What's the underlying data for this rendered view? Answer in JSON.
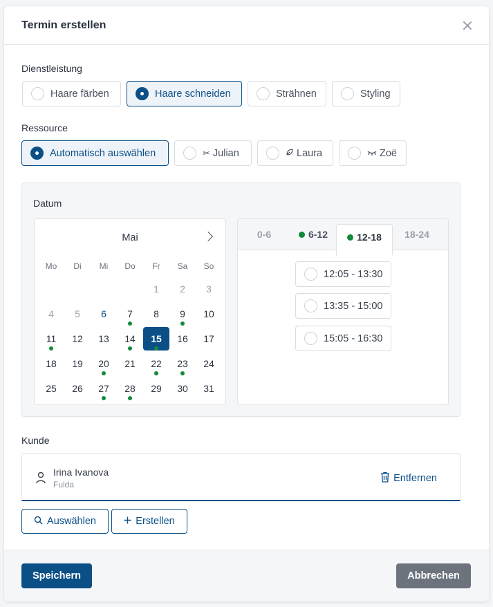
{
  "modal": {
    "title": "Termin erstellen"
  },
  "service": {
    "label": "Dienstleistung",
    "options": [
      {
        "label": "Haare färben",
        "selected": false
      },
      {
        "label": "Haare schneiden",
        "selected": true
      },
      {
        "label": "Strähnen",
        "selected": false
      },
      {
        "label": "Styling",
        "selected": false
      }
    ]
  },
  "resource": {
    "label": "Ressource",
    "options": [
      {
        "label": "Automatisch auswählen",
        "icon": "",
        "selected": true
      },
      {
        "label": "Julian",
        "icon": "scissors-icon",
        "selected": false
      },
      {
        "label": "Laura",
        "icon": "leaf-icon",
        "selected": false
      },
      {
        "label": "Zoë",
        "icon": "eyelash-icon",
        "selected": false
      }
    ]
  },
  "date": {
    "label": "Datum",
    "month": "Mai",
    "weekdays": [
      "Mo",
      "Di",
      "Mi",
      "Do",
      "Fr",
      "Sa",
      "So"
    ],
    "weeks": [
      [
        "",
        "",
        "",
        "",
        "1",
        "2",
        "3"
      ],
      [
        "4",
        "5",
        "6",
        "7",
        "8",
        "9",
        "10"
      ],
      [
        "11",
        "12",
        "13",
        "14",
        "15",
        "16",
        "17"
      ],
      [
        "18",
        "19",
        "20",
        "21",
        "22",
        "23",
        "24"
      ],
      [
        "25",
        "26",
        "27",
        "28",
        "29",
        "30",
        "31"
      ]
    ],
    "muted_days": [
      "1",
      "2",
      "3",
      "4",
      "5"
    ],
    "accent_days": [
      "6"
    ],
    "available_days": [
      "7",
      "9",
      "11",
      "14",
      "15",
      "20",
      "22",
      "23",
      "27",
      "28"
    ],
    "selected_day": "15"
  },
  "timeslots": {
    "tabs": [
      {
        "label": "0-6",
        "available": false,
        "active": false
      },
      {
        "label": "6-12",
        "available": true,
        "active": false
      },
      {
        "label": "12-18",
        "available": true,
        "active": true
      },
      {
        "label": "18-24",
        "available": false,
        "active": false
      }
    ],
    "slots": [
      "12:05 - 13:30",
      "13:35 - 15:00",
      "15:05 - 16:30"
    ]
  },
  "customer": {
    "label": "Kunde",
    "name": "Irina Ivanova",
    "city": "Fulda",
    "remove_label": "Entfernen",
    "select_label": "Auswählen",
    "create_label": "Erstellen"
  },
  "footer": {
    "save_label": "Speichern",
    "cancel_label": "Abbrechen"
  },
  "colors": {
    "primary": "#0b4f87",
    "available_dot": "#128a3a",
    "secondary_button": "#6c737d"
  }
}
